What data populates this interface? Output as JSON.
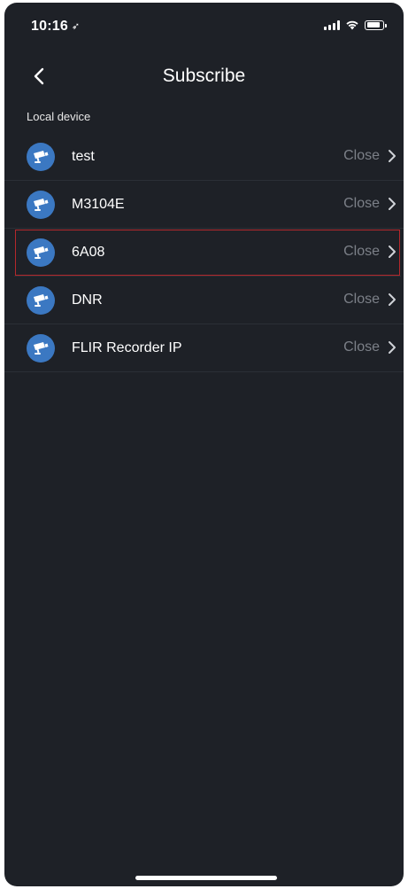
{
  "status_bar": {
    "time": "10:16",
    "location_glyph": "➶",
    "battery_level": 0.85,
    "signal_bars": 4
  },
  "nav": {
    "title": "Subscribe",
    "back_icon": "chevron-left-icon"
  },
  "section": {
    "header": "Local device"
  },
  "devices": [
    {
      "name": "test",
      "status": "Close",
      "icon": "camera-icon",
      "highlighted": false
    },
    {
      "name": "M3104E",
      "status": "Close",
      "icon": "camera-icon",
      "highlighted": false
    },
    {
      "name": "6A08",
      "status": "Close",
      "icon": "camera-icon",
      "highlighted": true
    },
    {
      "name": "DNR",
      "status": "Close",
      "icon": "camera-icon",
      "highlighted": false
    },
    {
      "name": "FLIR Recorder IP",
      "status": "Close",
      "icon": "camera-icon",
      "highlighted": false
    }
  ],
  "colors": {
    "background": "#1e2127",
    "avatar": "#3b78c2",
    "status_text": "#7c8088",
    "highlight_border": "#b4282c"
  }
}
